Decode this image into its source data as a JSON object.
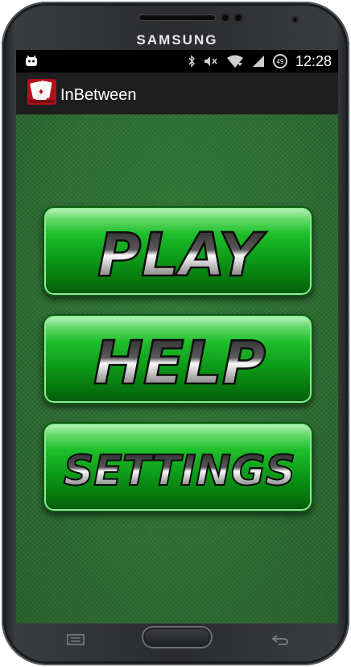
{
  "device": {
    "brand": "SAMSUNG"
  },
  "status_bar": {
    "time": "12:28",
    "battery_text": "49"
  },
  "app_bar": {
    "title": "InBetween",
    "icon": "playing-cards-icon"
  },
  "main_menu": {
    "buttons": [
      {
        "label": "PLAY"
      },
      {
        "label": "HELP"
      },
      {
        "label": "SETTINGS"
      }
    ]
  },
  "nav_bar": {
    "menu_icon": "menu-key-icon",
    "home_icon": "home-button",
    "back_icon": "back-arrow-icon"
  },
  "colors": {
    "felt": "#2b6d30",
    "button_green": "#1fbf2c",
    "action_bar": "#1e1e1e"
  }
}
